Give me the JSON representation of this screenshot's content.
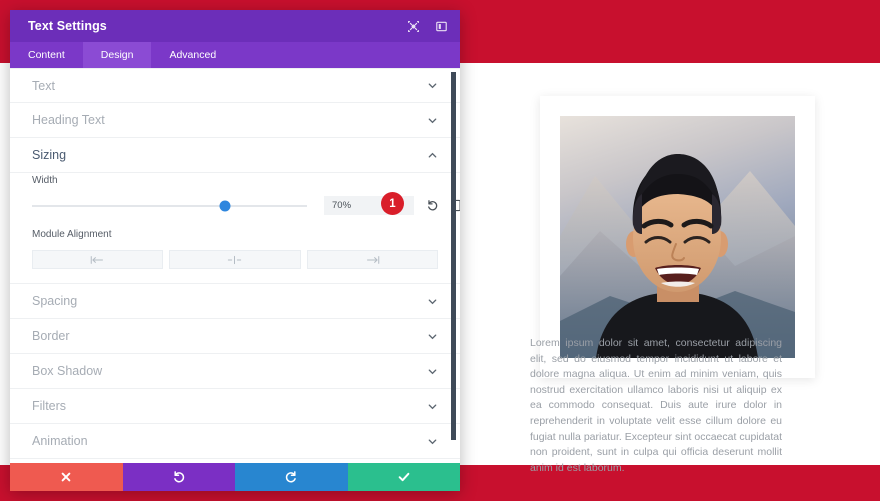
{
  "theme": {
    "background_red": "#C8102E",
    "header_purple": "#6C2EB9",
    "tabbar_purple": "#7B38C8",
    "tab_active_purple": "#8B4BD4",
    "slider_blue": "#2E86DE",
    "badge_red": "#D91E2A",
    "footer_cancel": "#EF5A50",
    "footer_undo": "#7B2FC4",
    "footer_redo": "#2886D0",
    "footer_save": "#2BBF8E"
  },
  "modal": {
    "title": "Text Settings",
    "header_icons": [
      {
        "name": "expand-icon",
        "label": "Expand"
      },
      {
        "name": "layout-panel-icon",
        "label": "Change Layout"
      }
    ],
    "tabs": [
      {
        "label": "Content",
        "active": false
      },
      {
        "label": "Design",
        "active": true
      },
      {
        "label": "Advanced",
        "active": false
      }
    ],
    "sections": [
      {
        "label": "Text",
        "open": false
      },
      {
        "label": "Heading Text",
        "open": false
      },
      {
        "label": "Sizing",
        "open": true
      },
      {
        "label": "Spacing",
        "open": false
      },
      {
        "label": "Border",
        "open": false
      },
      {
        "label": "Box Shadow",
        "open": false
      },
      {
        "label": "Filters",
        "open": false
      },
      {
        "label": "Animation",
        "open": false
      }
    ],
    "sizing": {
      "width_label": "Width",
      "width_value": "70%",
      "width_percent": 70,
      "badge": "1",
      "reset_icon": "reset-icon",
      "responsive_icon": "mobile-device-icon",
      "module_alignment_label": "Module Alignment",
      "alignment_options": [
        {
          "name": "align-left-icon",
          "label": "Left"
        },
        {
          "name": "align-center-icon",
          "label": "Center"
        },
        {
          "name": "align-right-icon",
          "label": "Right"
        }
      ]
    },
    "footer_buttons": [
      {
        "name": "cancel-button",
        "icon": "close-icon",
        "label": "Cancel"
      },
      {
        "name": "undo-button",
        "icon": "undo-icon",
        "label": "Undo"
      },
      {
        "name": "redo-button",
        "icon": "redo-icon",
        "label": "Redo"
      },
      {
        "name": "save-button",
        "icon": "check-icon",
        "label": "Save"
      }
    ]
  },
  "preview": {
    "image_alt": "smiling-man-portrait-mountains",
    "body_text": "Lorem ipsum dolor sit amet, consectetur adipiscing elit, sed do eiusmod tempor incididunt ut labore et dolore magna aliqua. Ut enim ad minim veniam, quis nostrud exercitation ullamco laboris nisi ut aliquip ex ea commodo consequat. Duis aute irure dolor in reprehenderit in voluptate velit esse cillum dolore eu fugiat nulla pariatur. Excepteur sint occaecat cupidatat non proident, sunt in culpa qui officia deserunt mollit anim id est laborum."
  }
}
